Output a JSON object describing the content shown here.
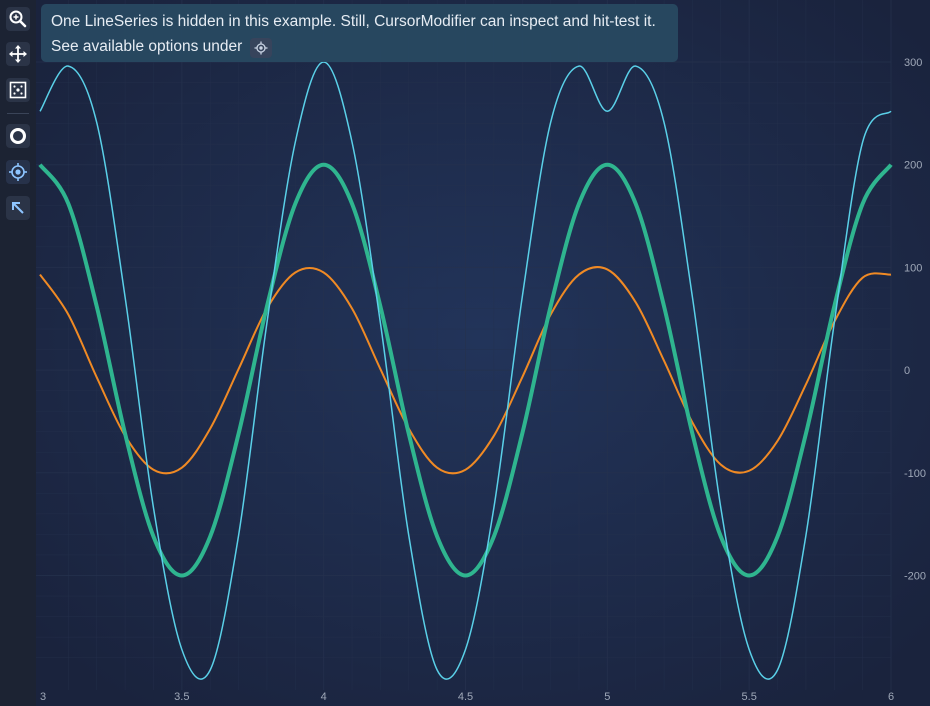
{
  "notice": {
    "line1": "One LineSeries is hidden in this example. Still, CursorModifier can inspect and hit-test it.",
    "line2": "See available options under"
  },
  "toolbar": {
    "tools": [
      "zoom-icon",
      "pan-icon",
      "zoom-extents-icon",
      "rollover-icon",
      "cursor-icon",
      "select-icon"
    ]
  },
  "colors": {
    "background": "#1b2540",
    "grid": "#26324e",
    "axis_text": "#9fa8b8",
    "series_orange": "#f08a24",
    "series_green": "#2fb58f",
    "series_cyan": "#5ad0e8"
  },
  "chart_data": {
    "type": "line",
    "title": "",
    "xlabel": "",
    "ylabel": "",
    "xlim": [
      3,
      6
    ],
    "ylim": [
      -290,
      300
    ],
    "x_ticks": [
      "3",
      "3.5",
      "4",
      "4.5",
      "5",
      "5.5",
      "6"
    ],
    "y_ticks": [
      "300",
      "200",
      "100",
      "0",
      "-100",
      "-200"
    ],
    "y_axis_position": "right",
    "grid": true,
    "series": [
      {
        "color": "#f08a24",
        "stroke_width": 2,
        "x": [
          3.0,
          3.1,
          3.2,
          3.3,
          3.4,
          3.5,
          3.6,
          3.7,
          3.8,
          3.9,
          4.0,
          4.1,
          4.2,
          4.3,
          4.4,
          4.5,
          4.6,
          4.7,
          4.8,
          4.9,
          5.0,
          5.1,
          5.2,
          5.3,
          5.4,
          5.5,
          5.6,
          5.7,
          5.8,
          5.9,
          6.0
        ],
        "y": [
          93,
          54,
          -7,
          -64,
          -97,
          -95,
          -57,
          1,
          60,
          95,
          95,
          60,
          1,
          -57,
          -95,
          -97,
          -64,
          -7,
          54,
          93,
          98,
          66,
          9,
          -51,
          -92,
          -98,
          -69,
          -14,
          47,
          90,
          93
        ]
      },
      {
        "color": "#2fb58f",
        "stroke_width": 4,
        "x": [
          3.0,
          3.1,
          3.2,
          3.3,
          3.4,
          3.5,
          3.6,
          3.7,
          3.8,
          3.9,
          4.0,
          4.1,
          4.2,
          4.3,
          4.4,
          4.5,
          4.6,
          4.7,
          4.8,
          4.9,
          5.0,
          5.1,
          5.2,
          5.3,
          5.4,
          5.5,
          5.6,
          5.7,
          5.8,
          5.9,
          6.0
        ],
        "y": [
          200,
          162,
          62,
          -62,
          -162,
          -200,
          -162,
          -62,
          62,
          162,
          200,
          162,
          62,
          -62,
          -162,
          -200,
          -162,
          -62,
          62,
          162,
          200,
          162,
          62,
          -62,
          -162,
          -200,
          -162,
          -62,
          62,
          162,
          200
        ]
      },
      {
        "color": "#5ad0e8",
        "stroke_width": 1.5,
        "x": [
          3.0,
          3.1,
          3.2,
          3.3,
          3.4,
          3.5,
          3.6,
          3.7,
          3.8,
          3.9,
          4.0,
          4.1,
          4.2,
          4.3,
          4.4,
          4.5,
          4.6,
          4.7,
          4.8,
          4.9,
          5.0,
          5.1,
          5.2,
          5.3,
          5.4,
          5.5,
          5.6,
          5.7,
          5.8,
          5.9,
          6.0
        ],
        "y": [
          252,
          296,
          241,
          71,
          -134,
          -272,
          -292,
          -161,
          46,
          222,
          300,
          222,
          46,
          -161,
          -292,
          -272,
          -134,
          71,
          241,
          296,
          252,
          296,
          241,
          71,
          -134,
          -272,
          -292,
          -161,
          46,
          222,
          252
        ]
      }
    ]
  }
}
